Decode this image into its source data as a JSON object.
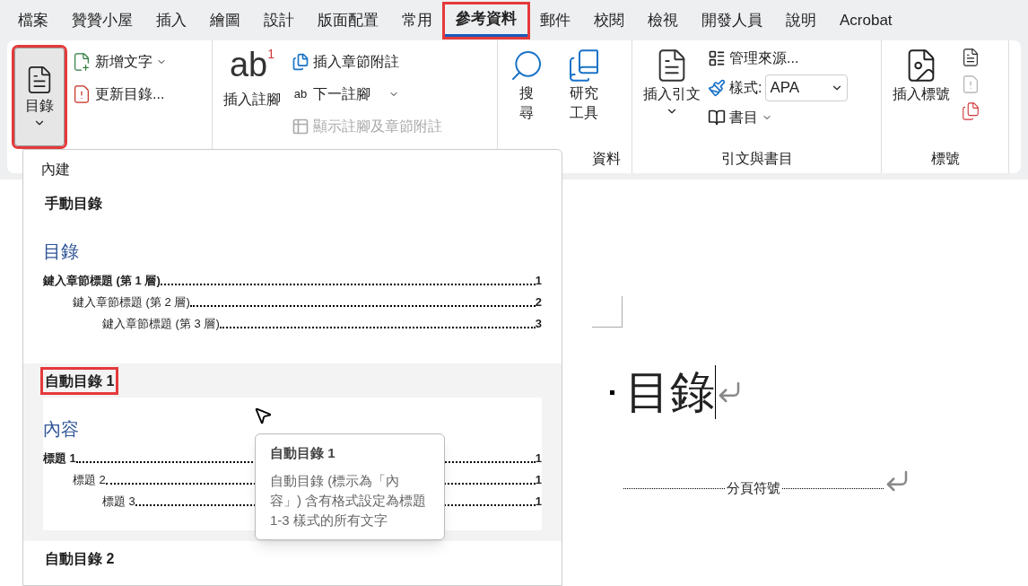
{
  "tabs": [
    {
      "label": "檔案",
      "selected": false,
      "highlighted": false
    },
    {
      "label": "贊贊小屋",
      "selected": false,
      "highlighted": false
    },
    {
      "label": "插入",
      "selected": false,
      "highlighted": false
    },
    {
      "label": "繪圖",
      "selected": false,
      "highlighted": false
    },
    {
      "label": "設計",
      "selected": false,
      "highlighted": false
    },
    {
      "label": "版面配置",
      "selected": false,
      "highlighted": false
    },
    {
      "label": "常用",
      "selected": false,
      "highlighted": false
    },
    {
      "label": "參考資料",
      "selected": true,
      "highlighted": true
    },
    {
      "label": "郵件",
      "selected": false,
      "highlighted": false
    },
    {
      "label": "校閱",
      "selected": false,
      "highlighted": false
    },
    {
      "label": "檢視",
      "selected": false,
      "highlighted": false
    },
    {
      "label": "開發人員",
      "selected": false,
      "highlighted": false
    },
    {
      "label": "說明",
      "selected": false,
      "highlighted": false
    },
    {
      "label": "Acrobat",
      "selected": false,
      "highlighted": false
    }
  ],
  "ribbon": {
    "toc": {
      "label": "目錄",
      "expanded": true,
      "highlighted": true,
      "add_text": "新增文字",
      "update": "更新目錄..."
    },
    "footnotes": {
      "footnote_icon_text": "ab",
      "footnote_icon_mark": "1",
      "insert_footnote": "插入註腳",
      "insert_endnote": "插入章節附註",
      "next_icon_text": "ab",
      "next_footnote": "下一註腳",
      "show_notes": "顯示註腳及章節附註",
      "show_notes_disabled": true
    },
    "research": {
      "search": "搜尋",
      "researcher": "研究工具",
      "group_label": "資料"
    },
    "citations": {
      "insert_citation": "插入引文",
      "manage_sources": "管理來源...",
      "style_label": "樣式:",
      "style_value": "APA",
      "bibliography": "書目",
      "group_label": "引文與書目"
    },
    "captions": {
      "insert_caption": "插入標號",
      "group_label": "標號"
    }
  },
  "gallery": {
    "section": "內建",
    "items": [
      {
        "label": "手動目錄",
        "selected": false,
        "highlighted": false,
        "preview_title": "目錄",
        "entries": [
          {
            "text": "鍵入章節標題 (第 1 層)",
            "page": "1",
            "children": [
              {
                "text": "鍵入章節標題 (第 2 層)",
                "page": "2",
                "children": [
                  {
                    "text": "鍵入章節標題 (第 3 層)",
                    "page": "3"
                  }
                ]
              }
            ]
          }
        ]
      },
      {
        "label": "自動目錄 1",
        "selected": true,
        "highlighted": true,
        "preview_title": "內容",
        "entries": [
          {
            "text": "標題 1",
            "page": "1",
            "children": [
              {
                "text": "標題 2",
                "page": "1",
                "children": [
                  {
                    "text": "標題 3",
                    "page": "1"
                  }
                ]
              }
            ]
          }
        ]
      },
      {
        "label": "自動目錄 2",
        "selected": false,
        "highlighted": false
      }
    ]
  },
  "tooltip": {
    "title": "自動目錄 1",
    "body": "自動目錄 (標示為「內容」) 含有格式設定為標題 1-3 樣式的所有文字"
  },
  "document": {
    "heading": "目錄",
    "page_break": "分頁符號"
  }
}
